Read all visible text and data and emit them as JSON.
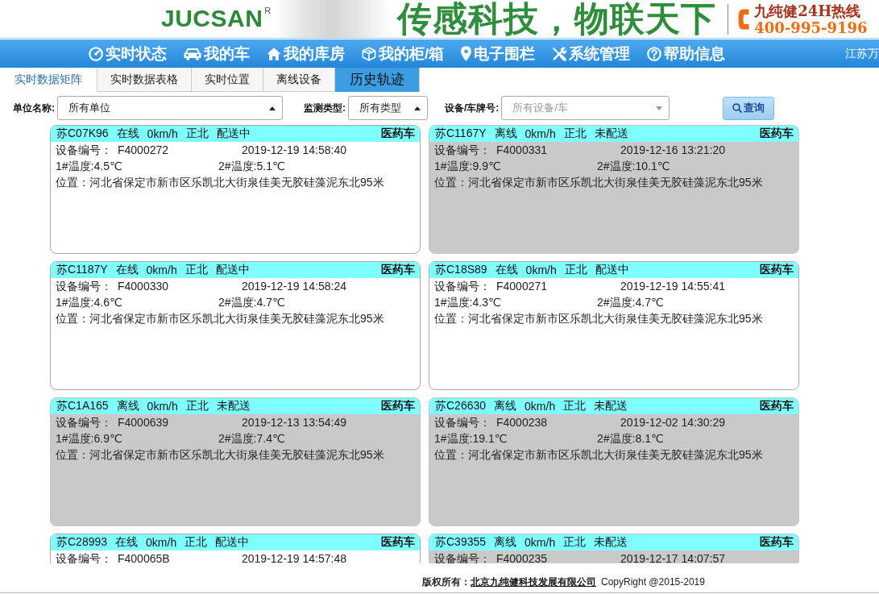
{
  "banner": {
    "logo": "JUCSAN",
    "logo_mark": "R",
    "slogan": "传感科技，物联天下",
    "hotline_label": "九纯健24H热线",
    "hotline_number": "400-995-9196"
  },
  "nav": {
    "items": [
      {
        "label": "实时状态"
      },
      {
        "label": "我的车"
      },
      {
        "label": "我的库房"
      },
      {
        "label": "我的柜/箱"
      },
      {
        "label": "电子围栏"
      },
      {
        "label": "系统管理"
      },
      {
        "label": "帮助信息"
      }
    ],
    "user": "江苏万"
  },
  "tabs": [
    {
      "label": "实时数据矩阵",
      "selected": true,
      "highlighted": false
    },
    {
      "label": "实时数据表格",
      "selected": false,
      "highlighted": false
    },
    {
      "label": "实时位置",
      "selected": false,
      "highlighted": false
    },
    {
      "label": "离线设备",
      "selected": false,
      "highlighted": false
    },
    {
      "label": "历史轨迹",
      "selected": false,
      "highlighted": true
    }
  ],
  "filters": [
    {
      "kind": "select",
      "label": "单位名称:",
      "value": "所有单位"
    },
    {
      "kind": "select",
      "label": "监测类型:",
      "value": "所有类型"
    },
    {
      "kind": "combo",
      "label": "设备/车牌号:",
      "placeholder": "所有设备/车"
    }
  ],
  "search_button": {
    "label": "查询"
  },
  "cards": [
    {
      "plate": "苏C07K96",
      "status": "在线",
      "speed": "0km/h",
      "direction": "正北",
      "delivery": "配送中",
      "vehicle_type": "医药车",
      "online": true,
      "device_label": "设备编号：",
      "device_id": "F4000272",
      "time": "2019-12-19 14:58:40",
      "temp_1": "1#温度:4.5℃",
      "temp_2": "2#温度:5.1℃",
      "location": "位置：河北省保定市新市区乐凯北大街泉佳美无胶硅藻泥东北95米"
    },
    {
      "plate": "苏C1167Y",
      "status": "离线",
      "speed": "0km/h",
      "direction": "正北",
      "delivery": "未配送",
      "vehicle_type": "医药车",
      "online": false,
      "device_label": "设备编号：",
      "device_id": "F4000331",
      "time": "2019-12-16 13:21:20",
      "temp_1": "1#温度:9.9℃",
      "temp_2": "2#温度:10.1℃",
      "location": "位置：河北省保定市新市区乐凯北大街泉佳美无胶硅藻泥东北95米"
    },
    {
      "plate": "苏C1187Y",
      "status": "在线",
      "speed": "0km/h",
      "direction": "正北",
      "delivery": "配送中",
      "vehicle_type": "医药车",
      "online": true,
      "device_label": "设备编号：",
      "device_id": "F4000330",
      "time": "2019-12-19 14:58:24",
      "temp_1": "1#温度:4.6℃",
      "temp_2": "2#温度:4.7℃",
      "location": "位置：河北省保定市新市区乐凯北大街泉佳美无胶硅藻泥东北95米"
    },
    {
      "plate": "苏C18S89",
      "status": "在线",
      "speed": "0km/h",
      "direction": "正北",
      "delivery": "配送中",
      "vehicle_type": "医药车",
      "online": true,
      "device_label": "设备编号：",
      "device_id": "F4000271",
      "time": "2019-12-19 14:55:41",
      "temp_1": "1#温度:4.3℃",
      "temp_2": "2#温度:4.7℃",
      "location": "位置：河北省保定市新市区乐凯北大街泉佳美无胶硅藻泥东北95米"
    },
    {
      "plate": "苏C1A165",
      "status": "离线",
      "speed": "0km/h",
      "direction": "正北",
      "delivery": "未配送",
      "vehicle_type": "医药车",
      "online": false,
      "device_label": "设备编号：",
      "device_id": "F4000639",
      "time": "2019-12-13 13:54:49",
      "temp_1": "1#温度:6.9℃",
      "temp_2": "2#温度:7.4℃",
      "location": "位置：河北省保定市新市区乐凯北大街泉佳美无胶硅藻泥东北95米"
    },
    {
      "plate": "苏C26630",
      "status": "离线",
      "speed": "0km/h",
      "direction": "正北",
      "delivery": "未配送",
      "vehicle_type": "医药车",
      "online": false,
      "device_label": "设备编号：",
      "device_id": "F4000238",
      "time": "2019-12-02 14:30:29",
      "temp_1": "1#温度:19.1℃",
      "temp_2": "2#温度:8.1℃",
      "location": "位置：河北省保定市新市区乐凯北大街泉佳美无胶硅藻泥东北95米"
    },
    {
      "plate": "苏C28993",
      "status": "在线",
      "speed": "0km/h",
      "direction": "正北",
      "delivery": "配送中",
      "vehicle_type": "医药车",
      "online": true,
      "device_label": "设备编号：",
      "device_id": "F400065B",
      "time": "2019-12-19 14:57:48"
    },
    {
      "plate": "苏C39355",
      "status": "离线",
      "speed": "0km/h",
      "direction": "正北",
      "delivery": "未配送",
      "vehicle_type": "医药车",
      "online": false,
      "device_label": "设备编号：",
      "device_id": "F4000235",
      "time": "2019-12-17 14:07:57"
    }
  ],
  "footer": {
    "owner_label": "版权所有：",
    "company": "北京九纯健科技发展有限公司",
    "copyright": "CopyRight @2015-2019"
  }
}
